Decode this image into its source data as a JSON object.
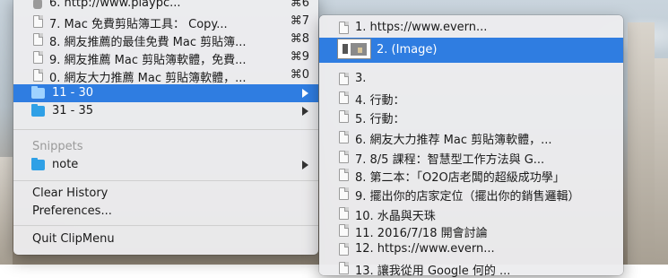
{
  "main_menu": {
    "history_items": [
      {
        "label": "6. http://www.playpc...",
        "shortcut": "⌘6"
      },
      {
        "label": "7. Mac 免費剪貼簿工具： Copy...",
        "shortcut": "⌘7"
      },
      {
        "label": "8. 網友推薦的最佳免費 Mac 剪貼簿...",
        "shortcut": "⌘8"
      },
      {
        "label": "9. 網友推薦 Mac 剪貼簿軟體，免費...",
        "shortcut": "⌘9"
      },
      {
        "label": "0. 網友大力推薦 Mac 剪貼簿軟體，...",
        "shortcut": "⌘0"
      }
    ],
    "folders": [
      {
        "label": "11 - 30"
      },
      {
        "label": "31 - 35"
      }
    ],
    "snippets_header": "Snippets",
    "snippet_folder": "note",
    "clear_history": "Clear History",
    "preferences": "Preferences...",
    "quit": "Quit ClipMenu"
  },
  "submenu": {
    "items": [
      "1. https://www.evern...",
      "2. (Image)",
      "3.",
      "4. 行動：",
      "5. 行動：",
      "6. 網友大力推荐 Mac 剪貼簿軟體，...",
      "7. 8/5 課程：智慧型工作方法與 G...",
      "8. 第二本：「O2O店老闆的超級成功學」",
      "9. 擺出你的店家定位（擺出你的銷售邏輯）",
      "10. 水晶與天珠",
      "11. 2016/7/18 開會討論",
      "12. https://www.evern...",
      "13. 讓我從用 Google 何的 ..."
    ]
  },
  "colors": {
    "selection": "#2f7de1",
    "folder": "#2fa0e6"
  }
}
